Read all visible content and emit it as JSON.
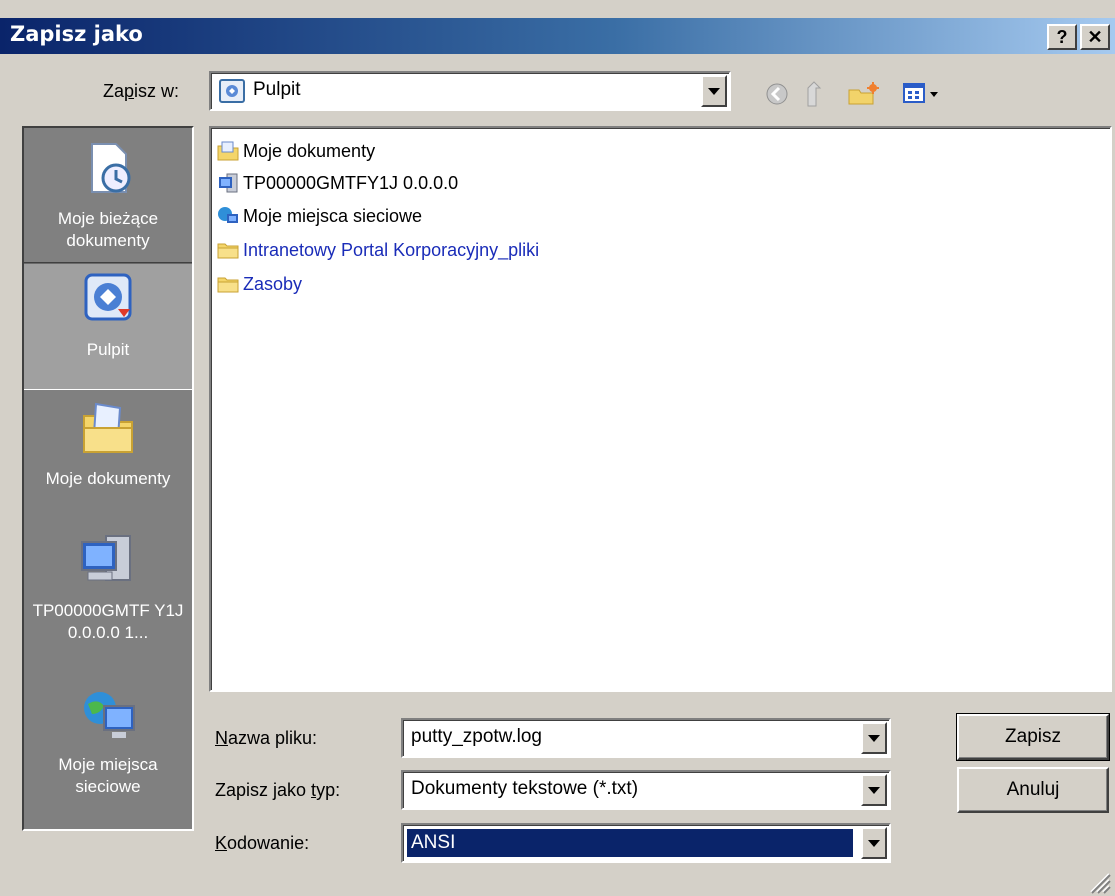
{
  "window": {
    "title": "Zapisz jako",
    "help_label": "?",
    "close_label": "✕"
  },
  "save_in": {
    "label": "Zapisz w:",
    "value": "Pulpit"
  },
  "places": [
    {
      "label": "Moje bieżące dokumenty",
      "icon": "recent-documents-icon"
    },
    {
      "label": "Pulpit",
      "icon": "desktop-icon",
      "active": true
    },
    {
      "label": "Moje dokumenty",
      "icon": "my-documents-icon"
    },
    {
      "label": "TP00000GMTF Y1J 0.0.0.0 1...",
      "icon": "computer-icon"
    },
    {
      "label": "Moje miejsca sieciowe",
      "icon": "network-places-icon"
    }
  ],
  "files": [
    {
      "name": "Moje dokumenty",
      "icon": "my-documents-folder-icon",
      "type": "system"
    },
    {
      "name": "TP00000GMTFY1J 0.0.0.0",
      "icon": "computer-icon",
      "type": "system"
    },
    {
      "name": "Moje miejsca sieciowe",
      "icon": "network-icon",
      "type": "system"
    },
    {
      "name": "Intranetowy Portal Korporacyjny_pliki",
      "icon": "folder-icon",
      "type": "folder"
    },
    {
      "name": "Zasoby",
      "icon": "folder-icon",
      "type": "folder"
    }
  ],
  "form": {
    "filename_label": "Nazwa pliku:",
    "filename_value": "putty_zpotw.log",
    "filetype_label": "Zapisz jako typ:",
    "filetype_value": "Dokumenty tekstowe (*.txt)",
    "encoding_label": "Kodowanie:",
    "encoding_value": "ANSI"
  },
  "buttons": {
    "save": "Zapisz",
    "cancel": "Anuluj"
  },
  "colors": {
    "title_start": "#0a246a",
    "title_end": "#a6caf0",
    "dialog_bg": "#d4d0c8",
    "selection": "#0a246a",
    "folder_text": "#1a2cb8"
  }
}
